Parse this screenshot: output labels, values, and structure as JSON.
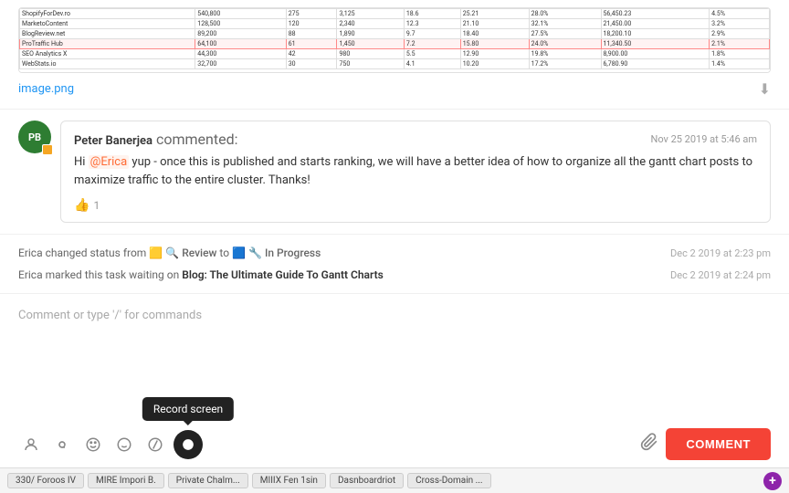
{
  "image_section": {
    "filename": "image.png",
    "download_tooltip": "Download"
  },
  "comment": {
    "avatar_initials": "PB",
    "commenter_name": "Peter Banerjea",
    "commented_label": "commented:",
    "timestamp": "Nov 25 2019 at 5:46 am",
    "mention": "@Erica",
    "body_before": "Hi ",
    "body_after": " yup - once this is published and starts ranking, we will have a better idea of how to organize all the gantt chart posts to maximize traffic to the entire cluster. Thanks!",
    "like_count": "1"
  },
  "activities": [
    {
      "text_before": "Erica changed status from",
      "from_status": "Review",
      "to_label": "to",
      "to_status": "In Progress",
      "timestamp": "Dec 2 2019 at 2:23 pm"
    },
    {
      "text_before": "Erica marked this task waiting on",
      "task_link": "Blog: The Ultimate Guide To Gantt Charts",
      "timestamp": "Dec 2 2019 at 2:24 pm"
    }
  ],
  "comment_input": {
    "placeholder": "Comment or type '/' for commands"
  },
  "toolbar": {
    "icons": [
      {
        "name": "person-icon",
        "symbol": "👤",
        "label": "Assign"
      },
      {
        "name": "at-icon",
        "symbol": "@",
        "label": "Mention"
      },
      {
        "name": "emoji-positive-icon",
        "symbol": "🙂",
        "label": "Emoji"
      },
      {
        "name": "emoji-smile-icon",
        "symbol": "😊",
        "label": "Smile"
      },
      {
        "name": "slash-icon",
        "symbol": "/",
        "label": "Commands"
      },
      {
        "name": "record-icon",
        "symbol": "⏺",
        "label": "Record screen"
      }
    ],
    "attachment_label": "📎",
    "submit_label": "COMMENT",
    "tooltip_text": "Record screen"
  },
  "taskbar": {
    "items": [
      "330/ Foroos IV",
      "MIRE Impori B.",
      "Private Chalm...",
      "MIIIX Fen 1sin",
      "Dasnboardriot",
      "Cross-Domain ..."
    ],
    "plus_label": "+"
  }
}
